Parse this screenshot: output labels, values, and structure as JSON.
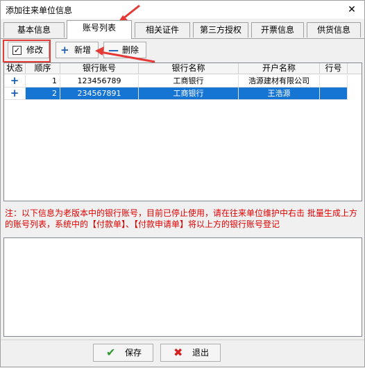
{
  "window": {
    "title": "添加往来单位信息",
    "close_glyph": "✕"
  },
  "tabs": [
    {
      "label": "基本信息",
      "active": false
    },
    {
      "label": "账号列表",
      "active": true
    },
    {
      "label": "相关证件",
      "active": false
    },
    {
      "label": "第三方授权",
      "active": false
    },
    {
      "label": "开票信息",
      "active": false
    },
    {
      "label": "供货信息",
      "active": false
    }
  ],
  "toolbar": {
    "edit_label": "修改",
    "add_label": "新增",
    "delete_label": "删除"
  },
  "grid": {
    "columns": [
      "状态",
      "顺序",
      "银行账号",
      "银行名称",
      "开户名称",
      "行号"
    ],
    "rows": [
      {
        "status": "+",
        "order": "1",
        "account": "123456789",
        "bank": "工商银行",
        "holder": "浩源建材有限公司",
        "code": ""
      },
      {
        "status": "+",
        "order": "2",
        "account": "234567891",
        "bank": "工商银行",
        "holder": "王浩源",
        "code": ""
      }
    ]
  },
  "note": "注：以下信息为老版本中的银行账号，目前已停止使用，请在往来单位维护中右击 批量生成上方的账号列表，系统中的【付款单】、【付款申请单】将以上方的银行账号登记",
  "footer": {
    "save_label": "保存",
    "exit_label": "退出"
  },
  "colors": {
    "selection": "#1674d3",
    "highlight": "#e53935",
    "note": "#e00000"
  }
}
